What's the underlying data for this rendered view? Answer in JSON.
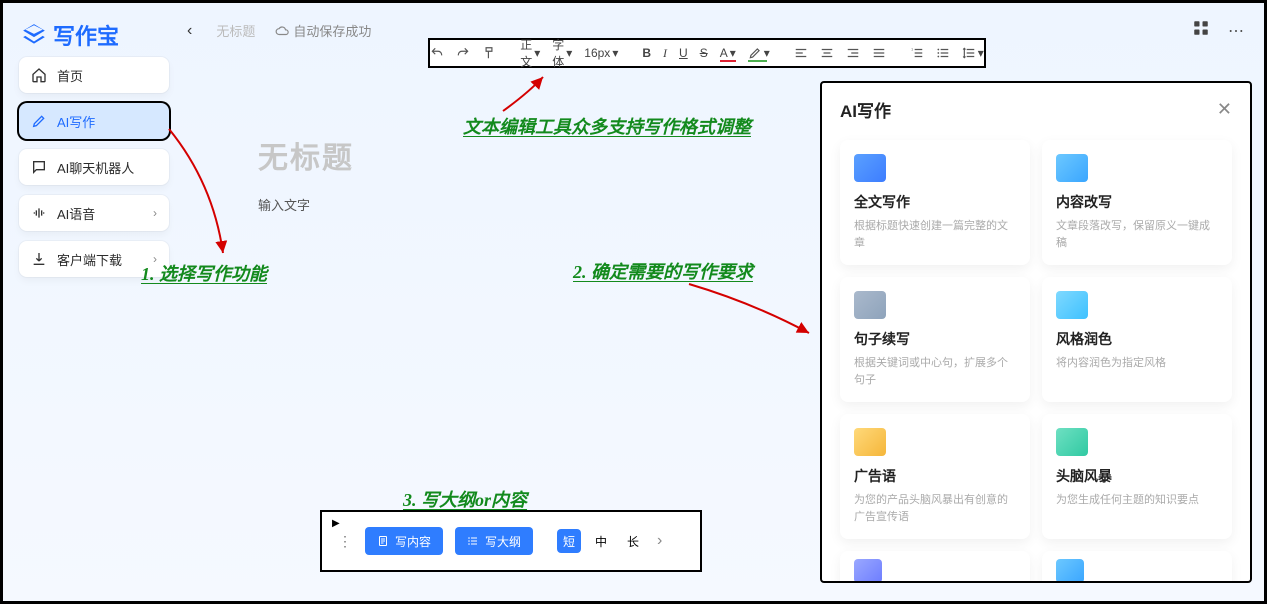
{
  "app": {
    "name": "写作宝"
  },
  "header": {
    "untitled": "无标题",
    "autosave": "自动保存成功"
  },
  "sidebar": {
    "items": [
      {
        "label": "首页"
      },
      {
        "label": "AI写作"
      },
      {
        "label": "AI聊天机器人"
      },
      {
        "label": "AI语音"
      },
      {
        "label": "客户端下载"
      }
    ]
  },
  "toolbar": {
    "normal": "正文",
    "font": "字体",
    "size": "16px",
    "bold": "B",
    "italic": "I",
    "underline": "U",
    "strike": "S",
    "textcolor": "A"
  },
  "editor": {
    "title_placeholder": "无标题",
    "body_placeholder": "输入文字"
  },
  "bottombar": {
    "write_content": "写内容",
    "write_outline": "写大纲",
    "len_short": "短",
    "len_mid": "中",
    "len_long": "长"
  },
  "ai_panel": {
    "title": "AI写作",
    "cards": [
      {
        "title": "全文写作",
        "desc": "根据标题快速创建一篇完整的文章"
      },
      {
        "title": "内容改写",
        "desc": "文章段落改写，保留原义一键成稿"
      },
      {
        "title": "句子续写",
        "desc": "根据关键词或中心句，扩展多个句子"
      },
      {
        "title": "风格润色",
        "desc": "将内容润色为指定风格"
      },
      {
        "title": "广告语",
        "desc": "为您的产品头脑风暴出有创意的广告宣传语"
      },
      {
        "title": "头脑风暴",
        "desc": "为您生成任何主题的知识要点"
      }
    ]
  },
  "annotations": {
    "a1": "1. 选择写作功能",
    "a2": "文本编辑工具众多支持写作格式调整",
    "a3": "2. 确定需要的写作要求",
    "a4": "3. 写大纲or内容"
  },
  "icon_colors": {
    "full": "#4f8dff",
    "rewrite": "#54b4ff",
    "continue": "#8fa7c3",
    "style": "#55c8ff",
    "ad": "#f5c04d",
    "brain": "#3fc9a8"
  }
}
